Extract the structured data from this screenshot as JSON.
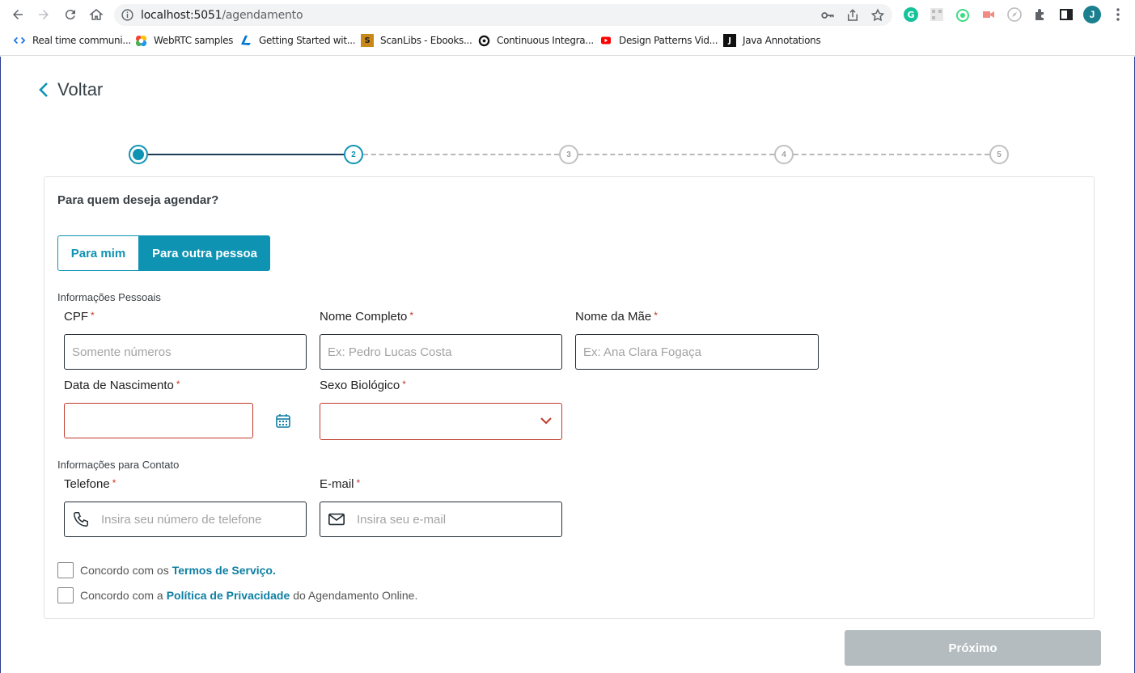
{
  "browser": {
    "url_host": "localhost:5051",
    "url_path": "/agendamento",
    "avatar_letter": "J",
    "bookmarks": [
      {
        "label": "Real time communi...",
        "icon": "code-icon"
      },
      {
        "label": "WebRTC samples",
        "icon": "webrtc-icon"
      },
      {
        "label": "Getting Started wit...",
        "icon": "azure-icon"
      },
      {
        "label": "ScanLibs - Ebooks...",
        "icon": "scanlibs-icon"
      },
      {
        "label": "Continuous Integra...",
        "icon": "ci-icon"
      },
      {
        "label": "Design Patterns Vid...",
        "icon": "youtube-icon"
      },
      {
        "label": "Java Annotations",
        "icon": "j-icon"
      }
    ]
  },
  "nav": {
    "back_label": "Voltar"
  },
  "stepper": {
    "steps": [
      "",
      "2",
      "3",
      "4",
      "5"
    ],
    "current": 2
  },
  "form": {
    "question": "Para quem deseja agendar?",
    "seg_me": "Para mim",
    "seg_other": "Para outra pessoa",
    "section_personal": "Informações Pessoais",
    "section_contact": "Informações para Contato",
    "required_mark": "*",
    "cpf": {
      "label": "CPF",
      "placeholder": "Somente números"
    },
    "nome": {
      "label": "Nome Completo",
      "placeholder": "Ex: Pedro Lucas Costa"
    },
    "mae": {
      "label": "Nome da Mãe",
      "placeholder": "Ex: Ana Clara Fogaça"
    },
    "nascimento": {
      "label": "Data de Nascimento",
      "placeholder": ""
    },
    "sexo": {
      "label": "Sexo Biológico",
      "value": ""
    },
    "telefone": {
      "label": "Telefone",
      "placeholder": "Insira seu número de telefone"
    },
    "email": {
      "label": "E-mail",
      "placeholder": "Insira seu e-mail"
    },
    "terms": {
      "prefix": "Concordo com os",
      "link": "Termos de Serviço.",
      "suffix": ""
    },
    "privacy": {
      "prefix": "Concordo com a",
      "link": "Política de Privacidade",
      "suffix": "do Agendamento Online."
    },
    "next_label": "Próximo"
  },
  "colors": {
    "primary": "#0e93b3",
    "error": "#c0392b",
    "disabled": "#b4bcbf"
  }
}
